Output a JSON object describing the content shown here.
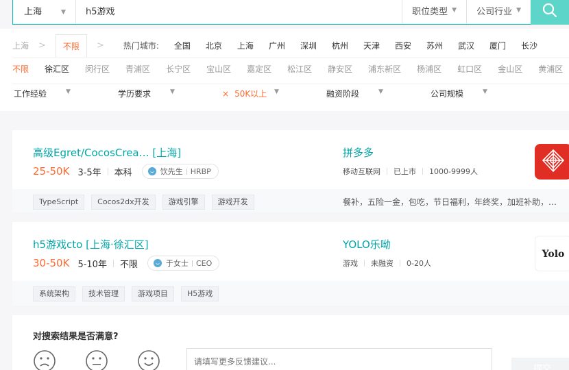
{
  "search": {
    "city": "上海",
    "query": "h5游戏",
    "job_type": "职位类型",
    "industry": "公司行业"
  },
  "location": {
    "crumb_city": "上海",
    "crumb_unlimited": "不限",
    "hot_cities_label": "热门城市:",
    "hot_cities": [
      "全国",
      "北京",
      "上海",
      "广州",
      "深圳",
      "杭州",
      "天津",
      "西安",
      "苏州",
      "武汉",
      "厦门",
      "长沙"
    ],
    "districts": [
      "不限",
      "徐汇区",
      "闵行区",
      "青浦区",
      "长宁区",
      "宝山区",
      "嘉定区",
      "松江区",
      "静安区",
      "浦东新区",
      "杨浦区",
      "虹口区",
      "金山区",
      "黄浦区"
    ]
  },
  "filters": {
    "experience": "工作经验",
    "education": "学历要求",
    "salary": "50K以上",
    "salary_clear": "×",
    "funding": "融资阶段",
    "size": "公司规模"
  },
  "jobs": [
    {
      "title": "高级Egret/CocosCrea…  [上海]",
      "salary": "25-50K",
      "experience": "3-5年",
      "education": "本科",
      "recruiter_name": "饮先生",
      "recruiter_role": "HRBP",
      "company": "拼多多",
      "company_industry": "移动互联网",
      "company_stage": "已上市",
      "company_size": "1000-9999人",
      "tags": [
        "TypeScript",
        "Cocos2dx开发",
        "游戏引擎",
        "游戏开发"
      ],
      "welfare": "餐补，五险一金，包吃，节日福利，年终奖，加班补助，…",
      "logo_color": "#e02e24"
    },
    {
      "title": "h5游戏cto  [上海·徐汇区]",
      "salary": "30-50K",
      "experience": "5-10年",
      "education": "不限",
      "recruiter_name": "于女士",
      "recruiter_role": "CEO",
      "company": "YOLO乐呦",
      "company_industry": "游戏",
      "company_stage": "未融资",
      "company_size": "0-20人",
      "tags": [
        "系统架构",
        "技术管理",
        "游戏项目",
        "H5游戏"
      ],
      "logo_text": "Yolo"
    }
  ],
  "feedback": {
    "title": "对搜索结果是否满意?",
    "placeholder": "请填写更多反馈建议...",
    "submit": "提交"
  },
  "colors": {
    "accent": "#00bebd",
    "link": "#00a6a7",
    "salary": "#fd6a30"
  }
}
